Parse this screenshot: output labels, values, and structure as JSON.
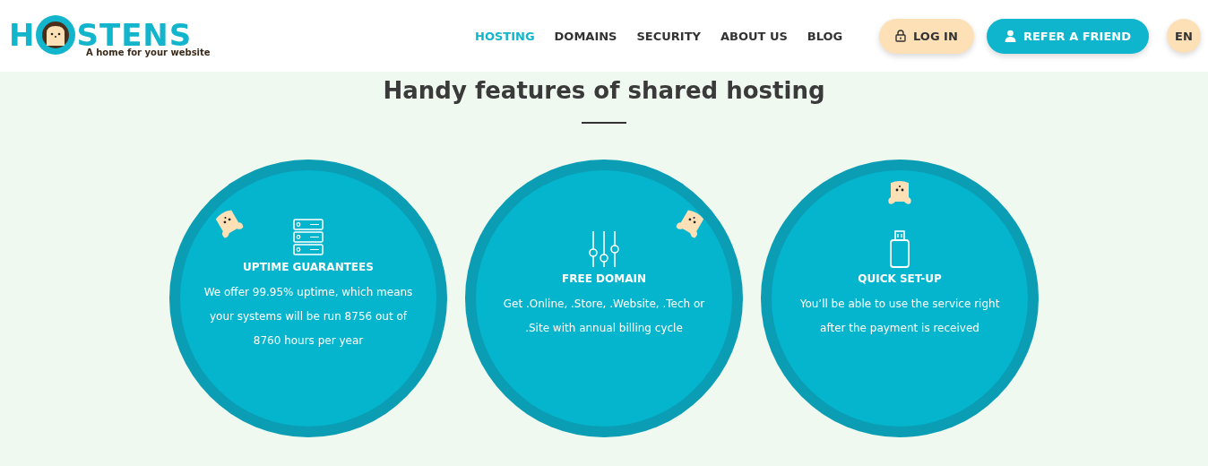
{
  "header": {
    "logo": {
      "left": "H",
      "right": "STENS",
      "tagline": "A home for your website"
    },
    "nav": [
      {
        "label": "HOSTING",
        "selected": true
      },
      {
        "label": "DOMAINS",
        "selected": false
      },
      {
        "label": "SECURITY",
        "selected": false
      },
      {
        "label": "ABOUT US",
        "selected": false
      },
      {
        "label": "BLOG",
        "selected": false
      }
    ],
    "login": "LOG IN",
    "refer": "REFER A FRIEND",
    "language": "EN"
  },
  "section": {
    "title": "Handy features of shared hosting",
    "features": [
      {
        "kind": "server",
        "title": "UPTIME GUARANTEES",
        "text": "We offer 99.95% uptime, which means your systems will be run 8756 out of 8760 hours per year"
      },
      {
        "kind": "sliders",
        "title": "FREE DOMAIN",
        "text": "Get .Online, .Store, .Website, .Tech or .Site with annual billing cycle"
      },
      {
        "kind": "usb",
        "title": "QUICK SET-UP",
        "text": "You’ll be able to use the service right after the payment is received"
      }
    ]
  }
}
